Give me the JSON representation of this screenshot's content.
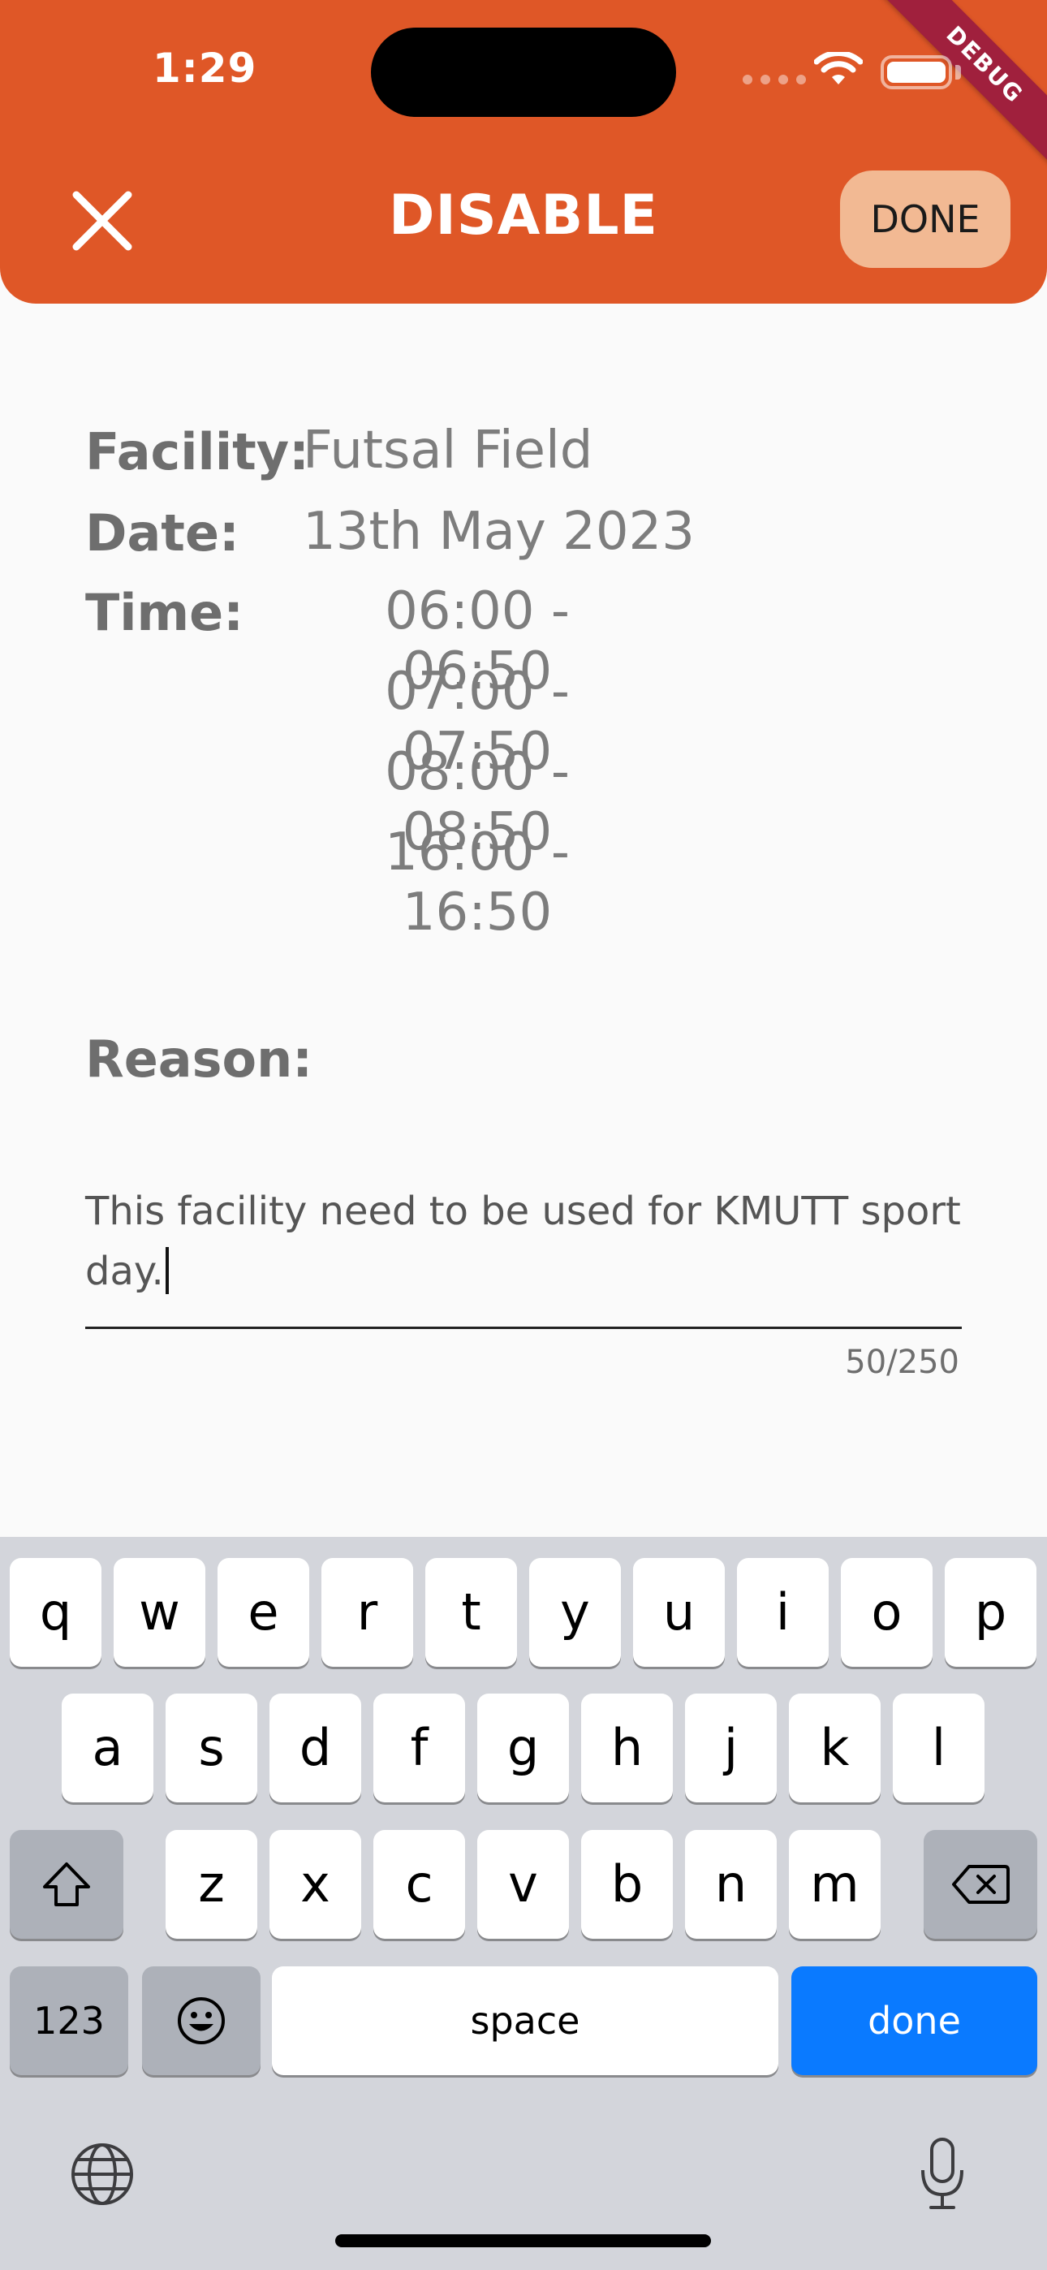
{
  "status_bar": {
    "time": "1:29"
  },
  "debug_banner": "DEBUG",
  "app_bar": {
    "title": "DISABLE",
    "done_label": "DONE"
  },
  "info": {
    "facility_label": "Facility:",
    "facility_value": "Futsal Field",
    "date_label": "Date:",
    "date_value": "13th May 2023",
    "time_label": "Time:",
    "time_slots": [
      "06:00 - 06:50",
      "07:00 - 07:50",
      "08:00 - 08:50",
      "16:00 - 16:50"
    ]
  },
  "reason": {
    "label": "Reason:",
    "value": "This facility need to be used for KMUTT sport day.",
    "counter": "50/250"
  },
  "keyboard": {
    "row1": [
      "q",
      "w",
      "e",
      "r",
      "t",
      "y",
      "u",
      "i",
      "o",
      "p"
    ],
    "row2": [
      "a",
      "s",
      "d",
      "f",
      "g",
      "h",
      "j",
      "k",
      "l"
    ],
    "row3": [
      "z",
      "x",
      "c",
      "v",
      "b",
      "n",
      "m"
    ],
    "numbers_label": "123",
    "space_label": "space",
    "done_label": "done"
  },
  "colors": {
    "app_bar": "#df5727",
    "done_button": "#f2b993",
    "debug_ribbon": "#a0203d",
    "keyboard_done": "#0a7aff"
  }
}
